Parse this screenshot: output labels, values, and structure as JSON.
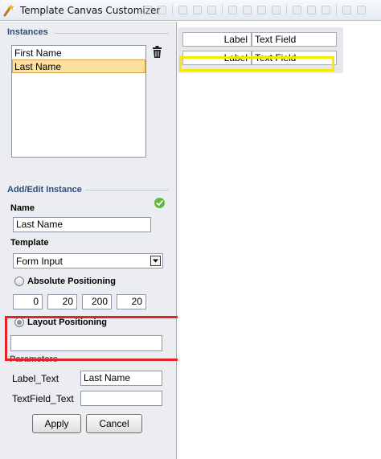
{
  "window": {
    "title": "Template Canvas Customizer"
  },
  "instances": {
    "header": "Instances",
    "items": [
      {
        "label": "First Name",
        "selected": false
      },
      {
        "label": "Last Name",
        "selected": true
      }
    ]
  },
  "add_edit": {
    "header": "Add/Edit Instance",
    "name_label": "Name",
    "name_value": "Last Name",
    "template_label": "Template",
    "template_value": "Form Input",
    "absolute_label": "Absolute Positioning",
    "absolute_checked": false,
    "x": "0",
    "y": "20",
    "width": "200",
    "height": "20",
    "layout_label": "Layout Positioning",
    "layout_checked": true,
    "layout_value": "",
    "parameters_label": "Parameters",
    "params": [
      {
        "name": "Label_Text",
        "value": "Last Name"
      },
      {
        "name": "TextField_Text",
        "value": ""
      }
    ]
  },
  "buttons": {
    "apply": "Apply",
    "cancel": "Cancel"
  },
  "canvas": {
    "rows": [
      {
        "label": "Label",
        "field": "Text Field"
      },
      {
        "label": "Label",
        "field": "Text Field"
      }
    ]
  },
  "colors": {
    "highlight_red": "#e3232b",
    "selection_yellow": "#f4ea00",
    "list_selected": "#fbe0a1",
    "valid_green": "#5fb83f"
  },
  "icons": {
    "app": "wand-icon",
    "delete": "trash-icon",
    "valid": "check-icon",
    "dropdown": "chevron-down-icon"
  }
}
